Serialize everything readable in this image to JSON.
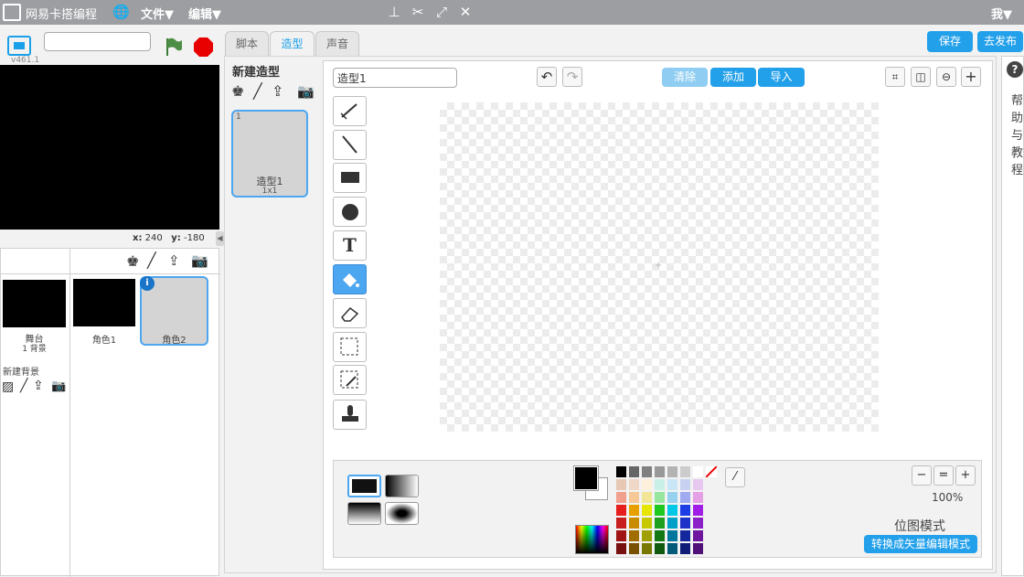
{
  "topbar": {
    "brand": "网易卡搭编程",
    "menu_file": "文件▼",
    "menu_edit": "编辑▼",
    "user_menu": "我▼"
  },
  "stage": {
    "version": "v461.1",
    "name_value": "",
    "coords": {
      "x_label": "x:",
      "x_value": "240",
      "y_label": "y:",
      "y_value": "-180"
    }
  },
  "sprites": {
    "stage_label": "舞台",
    "stage_sub": "1 背景",
    "sprite1": "角色1",
    "sprite2": "角色2",
    "new_backdrop": "新建背景"
  },
  "tabs": [
    "脚本",
    "造型",
    "声音"
  ],
  "actions": {
    "save": "保存",
    "publish": "去发布"
  },
  "costumes": {
    "heading": "新建造型",
    "item_index": "1",
    "item_name": "造型1",
    "item_size": "1x1"
  },
  "editor": {
    "costume_name": "造型1",
    "clear": "清除",
    "add": "添加",
    "import": "导入",
    "zoom": "100%",
    "mode": "位图模式",
    "convert": "转换成矢量编辑模式"
  },
  "help": {
    "label": "帮助与教程"
  },
  "colors": {
    "accent": "#23a0ea",
    "topbar": "#9c9ea2",
    "palette_rows": [
      [
        "#000000",
        "#666666",
        "#808080",
        "#999999",
        "#b3b3b3",
        "#cccccc",
        "#ffffff"
      ],
      [
        "#e6c8b4",
        "#f0d8c8",
        "#fff0dc",
        "#c8f0e6",
        "#c8e6f5",
        "#c8d2f0",
        "#e6c8f0"
      ],
      [
        "#f0a08c",
        "#f5c896",
        "#f0e696",
        "#96e6a0",
        "#96d2f0",
        "#a0aaf0",
        "#e6a0e6"
      ],
      [
        "#e61e1e",
        "#e6a000",
        "#e6e600",
        "#1ec81e",
        "#00c8e6",
        "#1e3ce6",
        "#a01ee6"
      ],
      [
        "#c81e1e",
        "#c88c00",
        "#c8c800",
        "#1ea01e",
        "#00a0c8",
        "#1e32c8",
        "#8c1ec8"
      ],
      [
        "#a01414",
        "#a06e00",
        "#a0a000",
        "#147814",
        "#00789e",
        "#14289e",
        "#6e149e"
      ],
      [
        "#781010",
        "#785000",
        "#787800",
        "#105a10",
        "#005a78",
        "#101e78",
        "#501078"
      ]
    ]
  }
}
